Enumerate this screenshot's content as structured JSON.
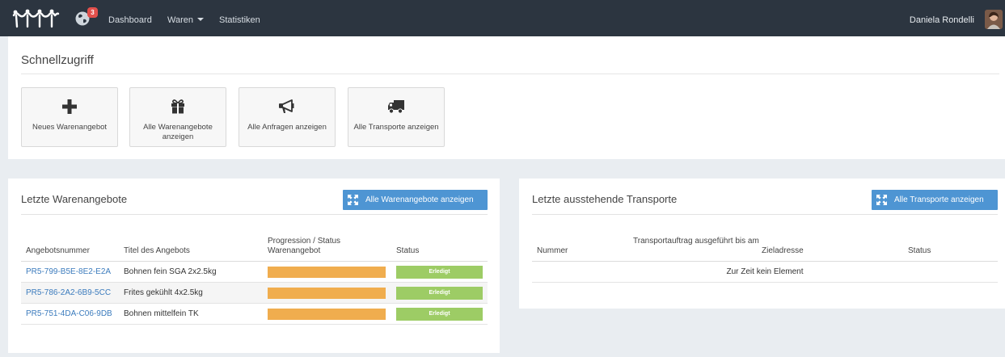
{
  "navbar": {
    "notification_count": "3",
    "links": [
      "Dashboard",
      "Waren",
      "Statistiken"
    ],
    "user_name": "Daniela Rondelli"
  },
  "quick": {
    "title": "Schnellzugriff",
    "tiles": [
      {
        "icon": "plus-icon",
        "label": "Neues Warenangebot"
      },
      {
        "icon": "gift-icon",
        "label": "Alle Warenangebote anzeigen"
      },
      {
        "icon": "megaphone-icon",
        "label": "Alle Anfragen anzeigen"
      },
      {
        "icon": "truck-icon",
        "label": "Alle Transporte anzeigen"
      }
    ]
  },
  "offers": {
    "title": "Letzte Warenangebote",
    "button": "Alle Warenangebote anzeigen",
    "headers": [
      "Angebotsnummer",
      "Titel des Angebots",
      "Progression / Status Warenangebot",
      "Status"
    ],
    "rows": [
      {
        "number": "PR5-799-B5E-8E2-E2A",
        "title": "Bohnen fein SGA 2x2.5kg",
        "progress": 100,
        "status": "Erledigt"
      },
      {
        "number": "PR5-786-2A2-6B9-5CC",
        "title": "Frites gekühlt 4x2.5kg",
        "progress": 100,
        "status": "Erledigt"
      },
      {
        "number": "PR5-751-4DA-C06-9DB",
        "title": "Bohnen mittelfein TK",
        "progress": 100,
        "status": "Erledigt"
      }
    ]
  },
  "transports": {
    "title": "Letzte ausstehende Transporte",
    "button": "Alle Transporte anzeigen",
    "headers": [
      "Nummer",
      "Transportauftrag ausgeführt bis am",
      "Zieladresse",
      "Status"
    ],
    "empty": "Zur Zeit kein Element"
  },
  "colors": {
    "navbar": "#2c3540",
    "accent": "#4e95d3",
    "progress": "#f0ad4e",
    "done": "#9dcc65",
    "badge": "#e2504c"
  }
}
